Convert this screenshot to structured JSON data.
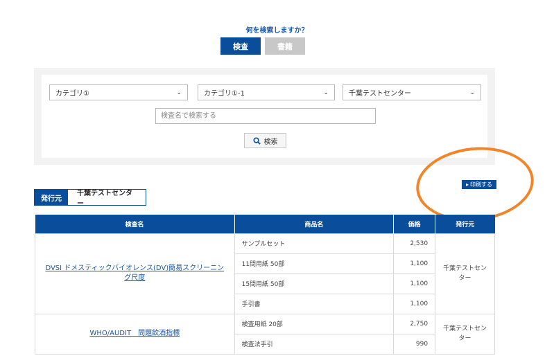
{
  "search": {
    "question": "何を検索しますか？",
    "tabs": [
      {
        "label": "検査",
        "active": true
      },
      {
        "label": "書籍",
        "active": false
      }
    ],
    "category1": "カテゴリ①",
    "category2": "カテゴリ①-1",
    "center": "千葉テストセンター",
    "keyword_placeholder": "検査名で検索する",
    "search_button": "検索"
  },
  "print_button": "印刷する",
  "publisher": {
    "label": "発行元",
    "value": "千葉テストセンター"
  },
  "table": {
    "headers": [
      "検査名",
      "商品名",
      "価格",
      "発行元"
    ],
    "groups": [
      {
        "name": "DVSI ドメスティックバイオレンス(DV)簡易スクリーニング尺度",
        "publisher": "千葉テストセンター",
        "items": [
          {
            "product": "サンプルセット",
            "price": "2,530"
          },
          {
            "product": "11問用紙 50部",
            "price": "1,100"
          },
          {
            "product": "15問用紙 50部",
            "price": "1,100"
          },
          {
            "product": "手引書",
            "price": "1,100"
          }
        ]
      },
      {
        "name": "WHO/AUDIT　問題飲酒指標",
        "publisher": "千葉テストセンター",
        "items": [
          {
            "product": "検査用紙 20部",
            "price": "2,750"
          },
          {
            "product": "検査法手引",
            "price": "990"
          }
        ]
      }
    ]
  },
  "colors": {
    "brand_blue": "#0a4e9b",
    "annotation_orange": "#f0852a"
  }
}
